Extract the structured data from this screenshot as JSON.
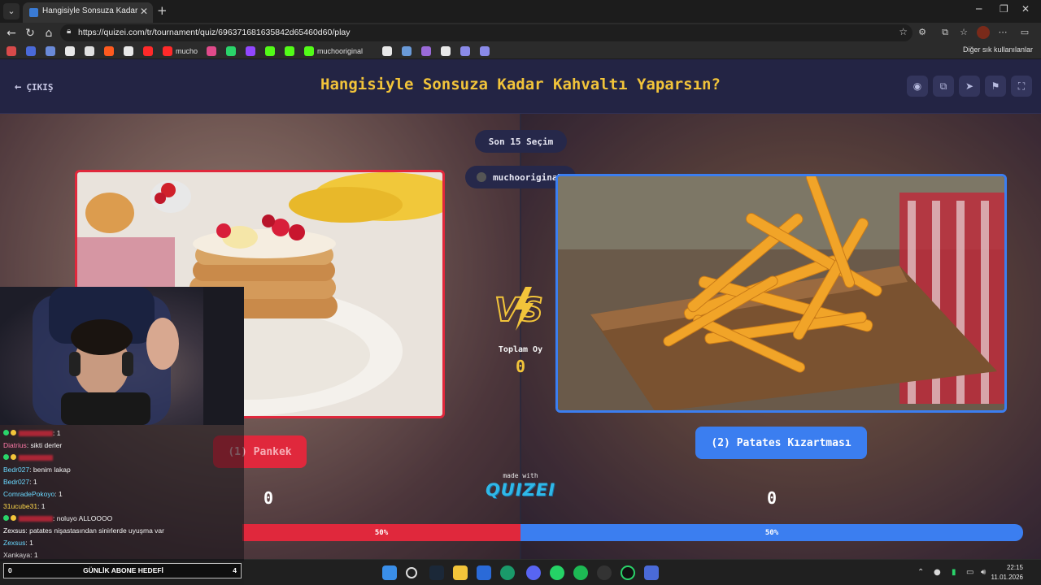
{
  "browser": {
    "tab_title": "Hangisiyle Sonsuza Kadar Kahvaltı",
    "url": "https://quizei.com/tr/tournament/quiz/696371681635842d65460d60/play",
    "bookmarks": [
      {
        "label": "",
        "color": "#d84a4a"
      },
      {
        "label": "",
        "color": "#4a6ad8"
      },
      {
        "label": "",
        "color": "#6a8ad8"
      },
      {
        "label": "",
        "color": "#e8e8e8"
      },
      {
        "label": "",
        "color": "#e0e0e0"
      },
      {
        "label": "",
        "color": "#ff5a1f"
      },
      {
        "label": "",
        "color": "#e8e8e8"
      },
      {
        "label": "",
        "color": "#ff2a2a"
      },
      {
        "label": "mucho",
        "color": "#ff2a2a"
      },
      {
        "label": "",
        "color": "#e04a8a"
      },
      {
        "label": "",
        "color": "#2ad46a"
      },
      {
        "label": "",
        "color": "#9147ff"
      },
      {
        "label": "",
        "color": "#53fc18"
      },
      {
        "label": "",
        "color": "#53fc18"
      },
      {
        "label": "muchooriginal",
        "color": "#53fc18"
      },
      {
        "label": "",
        "color": "#e8e8e8"
      },
      {
        "label": "",
        "color": "#6a9ad8"
      },
      {
        "label": "",
        "color": "#9a6ad8"
      },
      {
        "label": "",
        "color": "#e8e8e8"
      },
      {
        "label": "",
        "color": "#8a8ae8"
      },
      {
        "label": "",
        "color": "#8a8ae8"
      }
    ],
    "other_bookmarks": "Diğer sık kullanılanlar"
  },
  "quiz": {
    "exit_label": "ÇIKIŞ",
    "title": "Hangisiyle Sonsuza Kadar Kahvaltı Yaparsın?",
    "last_choices_label": "Son 15 Seçim",
    "user_label": "muchooriginal",
    "total_votes_label": "Toplam Oy",
    "total_votes": "0",
    "left_choice": "(1) Pankek",
    "right_choice": "(2) Patates Kızartması",
    "left_votes": "0",
    "right_votes": "0",
    "left_percent": "50%",
    "right_percent": "50%",
    "made_with": "made with",
    "logo_text": "QUIZEI",
    "colors": {
      "accent": "#f2c43a",
      "left": "#e0283c",
      "right": "#3b7ef0",
      "header": "#232444"
    }
  },
  "stream": {
    "chat": [
      {
        "user": "",
        "user_color": "#e0283c",
        "msg": ": 1",
        "badges": true
      },
      {
        "user": "Diatrius",
        "user_color": "#ff7aa8",
        "msg": ": sikti derler",
        "badges": false
      },
      {
        "user": "",
        "user_color": "#e0283c",
        "msg": "",
        "badges": true
      },
      {
        "user": "Bedr027",
        "user_color": "#6ad8ff",
        "msg": ": benim lakap",
        "badges": false
      },
      {
        "user": "Bedr027",
        "user_color": "#6ad8ff",
        "msg": ": 1",
        "badges": false
      },
      {
        "user": "ComradePokoyo",
        "user_color": "#6ad8ff",
        "msg": ": 1",
        "badges": false
      },
      {
        "user": "31ucube31",
        "user_color": "#ffd84a",
        "msg": ": 1",
        "badges": false
      },
      {
        "user": "",
        "user_color": "#e0283c",
        "msg": ": noluyo ALLOOOO",
        "badges": true
      },
      {
        "user": "Zexsus",
        "user_color": "#ffffff",
        "msg": ": patates nişastasından sinirlerde uyuşma var",
        "badges": false
      },
      {
        "user": "Zexsus",
        "user_color": "#6ad8ff",
        "msg": ": 1",
        "badges": false
      },
      {
        "user": "Xankaya",
        "user_color": "#d8d8d8",
        "msg": ": 1",
        "badges": false
      }
    ],
    "goal_left": "0",
    "goal_label": "GÜNLİK ABONE HEDEFİ",
    "goal_right": "4"
  },
  "taskbar": {
    "time": "22:15",
    "date": "11.01.2026"
  }
}
